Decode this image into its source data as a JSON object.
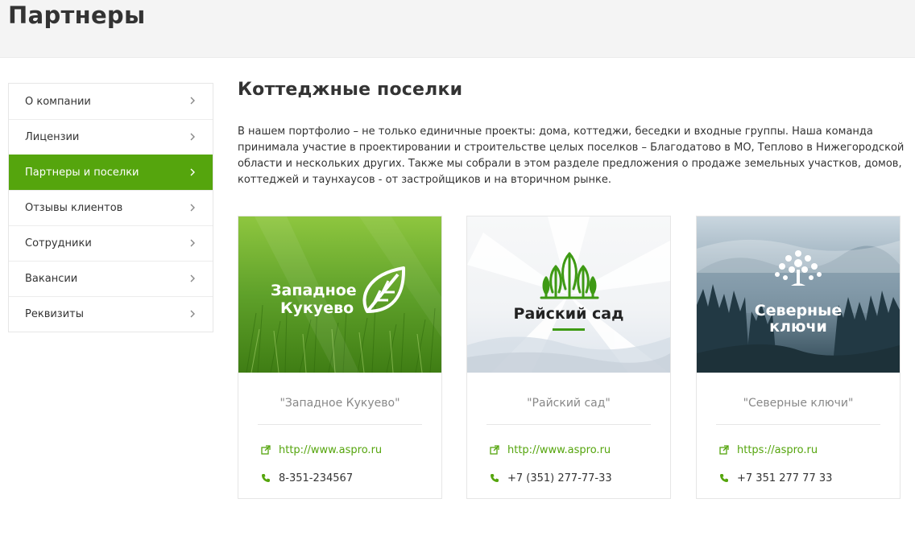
{
  "page": {
    "title": "Партнеры"
  },
  "sidebar": {
    "items": [
      {
        "label": "О компании"
      },
      {
        "label": "Лицензии"
      },
      {
        "label": "Партнеры и поселки"
      },
      {
        "label": "Отзывы клиентов"
      },
      {
        "label": "Сотрудники"
      },
      {
        "label": "Вакансии"
      },
      {
        "label": "Реквизиты"
      }
    ],
    "active_index": 2
  },
  "section": {
    "title": "Коттеджные поселки",
    "description": "В нашем портфолио – не только единичные проекты: дома, коттеджи, беседки и входные группы. Наша команда принимала участие в проектировании и строительстве целых поселков – Благодатово в МО, Теплово в Нижегородской области и нескольких других.  Также мы собрали в этом разделе предложения о продаже земельных участков, домов, коттеджей и таунхаусов - от застройщиков и на вторичном рынке."
  },
  "partners": [
    {
      "name": "\"Западное Кукуево\"",
      "logo_line1": "Западное",
      "logo_line2": "Кукуево",
      "site": "http://www.aspro.ru",
      "phone": "8-351-234567"
    },
    {
      "name": "\"Райский сад\"",
      "logo_line1": "Райский сад",
      "site": "http://www.aspro.ru",
      "phone": "+7 (351) 277-77-33"
    },
    {
      "name": "\"Северные ключи\"",
      "logo_line1": "Северные",
      "logo_line2": "ключи",
      "site": "https://aspro.ru",
      "phone": "+7 351 277 77 33"
    }
  ],
  "colors": {
    "accent": "#55a50d",
    "header_bg": "#f4f4f4",
    "muted_text": "#888888"
  },
  "icons": {
    "chevron": "chevron-right-icon",
    "site": "external-link-icon",
    "phone": "phone-icon"
  }
}
